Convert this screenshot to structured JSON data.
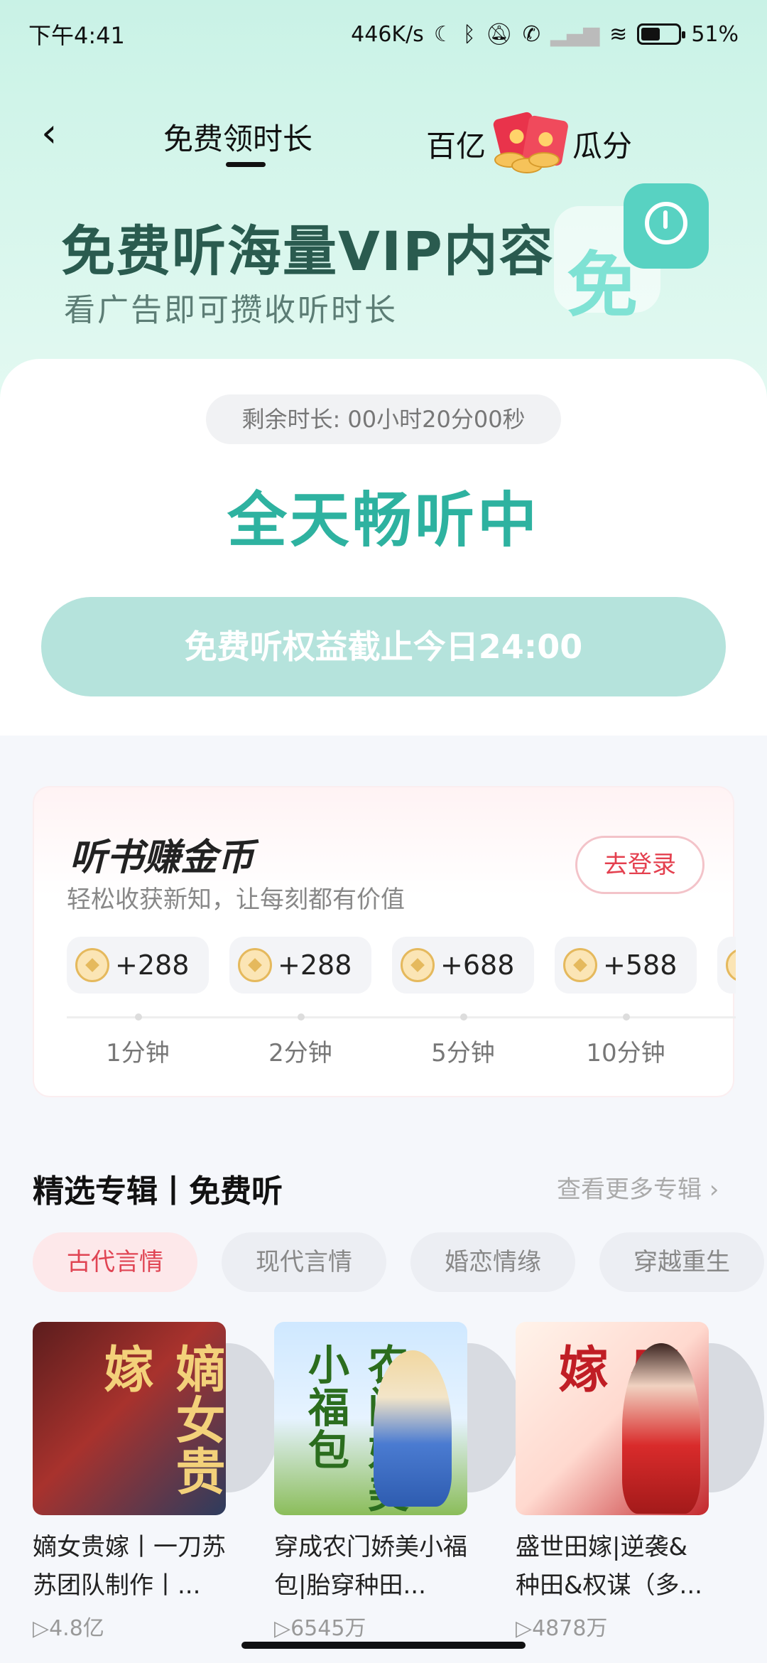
{
  "status_bar": {
    "time": "下午4:41",
    "speed": "446K/s",
    "battery": "51%",
    "battery_level": 0.51,
    "icons": [
      "moon-icon",
      "bluetooth-icon",
      "mute-icon",
      "call-icon",
      "signal-icon",
      "wifi-icon",
      "battery-icon"
    ]
  },
  "nav": {
    "tab_free": "免费领时长",
    "tab_bonus_left": "百亿",
    "tab_bonus_right": "瓜分"
  },
  "banner": {
    "title": "免费听海量VIP内容",
    "subtitle": "看广告即可攒收听时长",
    "art_glyph": "免"
  },
  "status": {
    "remaining": "剩余时长: 00小时20分00秒",
    "headline": "全天畅听中",
    "deadline": "免费听权益截止今日24:00"
  },
  "coins_card": {
    "title": "听书赚金币",
    "subtitle": "轻松收获新知，让每刻都有价值",
    "login": "去登录",
    "rewards": [
      {
        "amount": "+288",
        "time": "1分钟"
      },
      {
        "amount": "+288",
        "time": "2分钟"
      },
      {
        "amount": "+688",
        "time": "5分钟"
      },
      {
        "amount": "+588",
        "time": "10分钟"
      }
    ]
  },
  "section": {
    "title": "精选专辑丨免费听",
    "more": "查看更多专辑 ›",
    "chips": [
      "古代言情",
      "现代言情",
      "婚恋情缘",
      "穿越重生"
    ]
  },
  "albums": [
    {
      "cover_text": "嫡女贵嫁",
      "title": "嫡女贵嫁丨一刀苏苏团队制作丨...",
      "plays": "▷4.8亿"
    },
    {
      "cover_text": "农门娇美小福包",
      "title": "穿成农门娇美小福包|胎穿种田...",
      "plays": "▷6545万"
    },
    {
      "cover_text": "盛世田嫁",
      "title": "盛世田嫁|逆袭&种田&权谋（多...",
      "plays": "▷4878万"
    }
  ],
  "colors": {
    "accent_green": "#2eb2a0",
    "deadline_bg": "#b5e3dc",
    "login_red": "#e4404f",
    "chip_active": "#e04453"
  }
}
